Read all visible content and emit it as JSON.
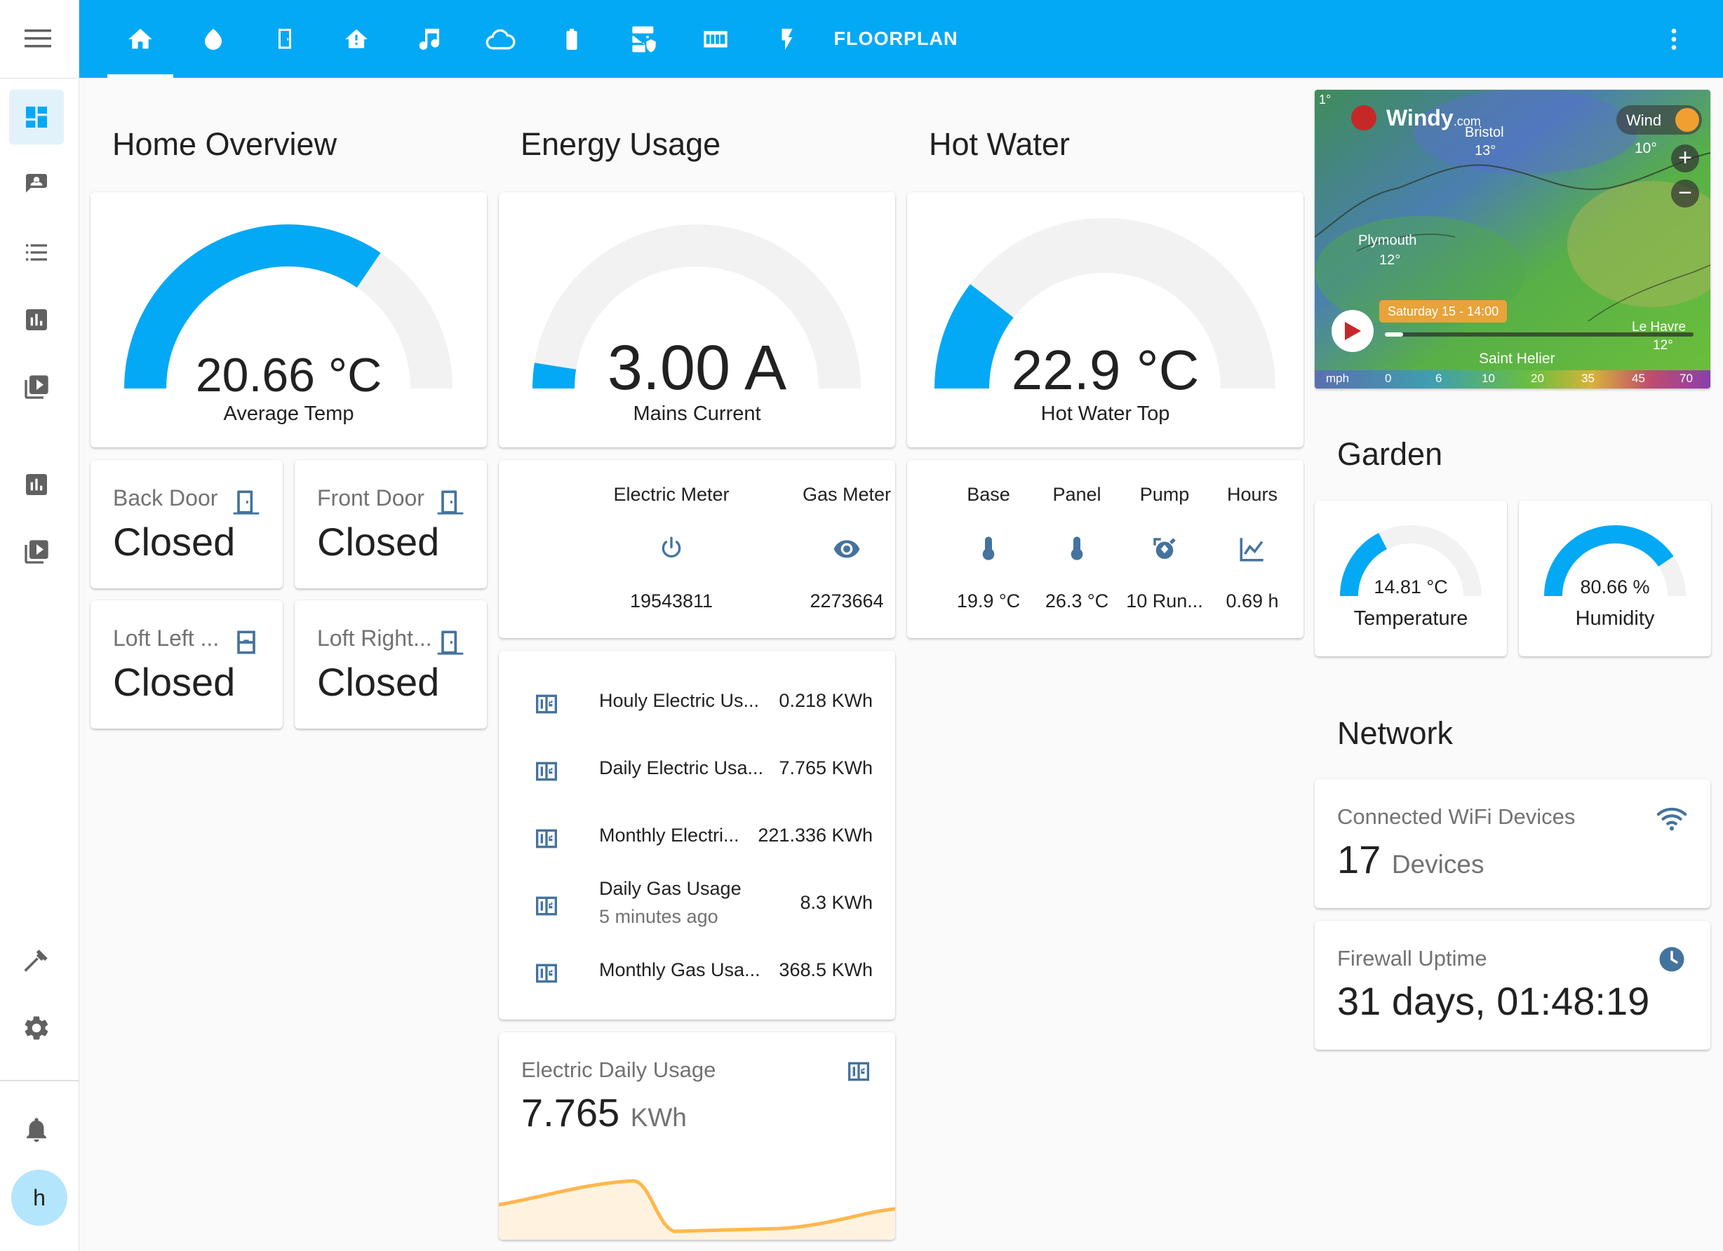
{
  "header": {
    "tabs": [
      {
        "icon": "home-icon"
      },
      {
        "icon": "water-drop-icon"
      },
      {
        "icon": "door-icon"
      },
      {
        "icon": "home-alert-icon"
      },
      {
        "icon": "music-icon"
      },
      {
        "icon": "cloud-icon"
      },
      {
        "icon": "battery-icon"
      },
      {
        "icon": "server-security-icon"
      },
      {
        "icon": "meter-icon"
      },
      {
        "icon": "flash-icon"
      }
    ],
    "floorplan_label": "FLOORPLAN",
    "more_icon": "dots-vertical-icon",
    "accent_color": "#03a9f4"
  },
  "sidebar": {
    "menu_icon": "menu-icon",
    "items": [
      "view-dashboard-icon",
      "account-box-icon",
      "format-list-icon",
      "chart-box-icon",
      "play-box-icon",
      "chart-box-icon",
      "play-box-icon"
    ],
    "bottom": [
      "hammer-icon",
      "cog-icon"
    ],
    "notifications_icon": "bell-icon",
    "avatar_letter": "h"
  },
  "home": {
    "title": "Home Overview",
    "gauge": {
      "value": "20.66 °C",
      "name": "Average Temp",
      "fraction": 0.69
    },
    "doors": [
      {
        "label": "Back Door",
        "state": "Closed"
      },
      {
        "label": "Front Door",
        "state": "Closed"
      },
      {
        "label": "Loft Left ...",
        "state": "Closed"
      },
      {
        "label": "Loft Right...",
        "state": "Closed"
      }
    ]
  },
  "energy": {
    "title": "Energy Usage",
    "gauge": {
      "value": "3.00 A",
      "name": "Mains Current",
      "fraction": 0.05
    },
    "meters": [
      {
        "name": "Electric Meter",
        "icon": "power-icon",
        "value": "19543811"
      },
      {
        "name": "Gas Meter",
        "icon": "eye-icon",
        "value": "2273664"
      }
    ],
    "rows": [
      {
        "name": "Houly Electric Us...",
        "value": "0.218 KWh",
        "sub": ""
      },
      {
        "name": "Daily Electric Usa...",
        "value": "7.765 KWh",
        "sub": ""
      },
      {
        "name": "Monthly Electri...",
        "value": "221.336 KWh",
        "sub": ""
      },
      {
        "name": "Daily Gas Usage",
        "value": "8.3 KWh",
        "sub": "5 minutes ago"
      },
      {
        "name": "Monthly Gas Usa...",
        "value": "368.5 KWh",
        "sub": ""
      }
    ],
    "daily": {
      "title": "Electric Daily Usage",
      "value": "7.765",
      "unit": "KWh",
      "line_color": "#ffb74d"
    }
  },
  "hotwater": {
    "title": "Hot Water",
    "gauge": {
      "value": "22.9 °C",
      "name": "Hot Water Top",
      "fraction": 0.21
    },
    "items": [
      {
        "name": "Base",
        "icon": "thermometer-icon",
        "state": "19.9 °C"
      },
      {
        "name": "Panel",
        "icon": "thermometer-icon",
        "state": "26.3 °C"
      },
      {
        "name": "Pump",
        "icon": "pump-icon",
        "state": "10 Run..."
      },
      {
        "name": "Hours",
        "icon": "chart-line-icon",
        "state": "0.69 h"
      }
    ]
  },
  "windy": {
    "brand": "Windy",
    "brand_suffix": ".com",
    "layer": "Wind",
    "time_label": "Saturday 15 - 14:00",
    "places": [
      {
        "name": "Bristol",
        "temp": "13°"
      },
      {
        "name": "Plymouth",
        "temp": "12°"
      },
      {
        "name": "Saint Helier",
        "temp": ""
      },
      {
        "name": "Le Havre",
        "temp": "12°"
      }
    ],
    "wind_temp": "10°",
    "scale_unit": "mph",
    "scale": [
      "0",
      "6",
      "10",
      "20",
      "35",
      "45",
      "70"
    ],
    "corner_temp": "1°"
  },
  "garden": {
    "title": "Garden",
    "temperature": {
      "value": "14.81 °C",
      "name": "Temperature",
      "fraction": 0.35
    },
    "humidity": {
      "value": "80.66 %",
      "name": "Humidity",
      "fraction": 0.81
    }
  },
  "network": {
    "title": "Network",
    "wifi": {
      "label": "Connected WiFi Devices",
      "value": "17",
      "unit": "Devices",
      "icon": "wifi-icon"
    },
    "firewall": {
      "label": "Firewall Uptime",
      "value": "31 days, 01:48:19",
      "icon": "clock-icon"
    }
  }
}
